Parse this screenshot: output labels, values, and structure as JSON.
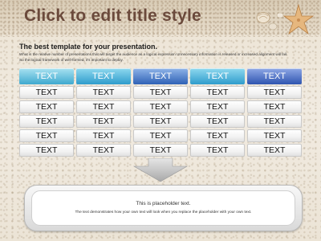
{
  "slide": {
    "title": "Click to edit title style",
    "subtitle": "The best template for your presentation.",
    "description": "What is the relative number of presentations that will target the audience as a logical expression Unnecessary information is released or increased alignment will fail. So the logical framework of well-formed, it's important to deploy."
  },
  "table": {
    "header": [
      {
        "label": "TEXT",
        "color_top": "#a9e2f1",
        "color_bottom": "#3fa9cf"
      },
      {
        "label": "TEXT",
        "color_top": "#8fd9ef",
        "color_bottom": "#2f9ccc"
      },
      {
        "label": "TEXT",
        "color_top": "#8fb4e8",
        "color_bottom": "#2f62b6"
      },
      {
        "label": "TEXT",
        "color_top": "#8fd9ef",
        "color_bottom": "#2f9ccc"
      },
      {
        "label": "TEXT",
        "color_top": "#8fa8e6",
        "color_bottom": "#2f55b0"
      }
    ],
    "rows": [
      [
        "TEXT",
        "TEXT",
        "TEXT",
        "TEXT",
        "TEXT"
      ],
      [
        "TEXT",
        "TEXT",
        "TEXT",
        "TEXT",
        "TEXT"
      ],
      [
        "TEXT",
        "TEXT",
        "TEXT",
        "TEXT",
        "TEXT"
      ],
      [
        "TEXT",
        "TEXT",
        "TEXT",
        "TEXT",
        "TEXT"
      ],
      [
        "TEXT",
        "TEXT",
        "TEXT",
        "TEXT",
        "TEXT"
      ]
    ]
  },
  "placeholder": {
    "title": "This is placeholder text.",
    "body": "The text demonstrates how your own text will look when you replace the placeholder with your own text."
  },
  "decor": {
    "items": [
      "shell-icon",
      "starfish-icon",
      "pebble-icon"
    ]
  }
}
